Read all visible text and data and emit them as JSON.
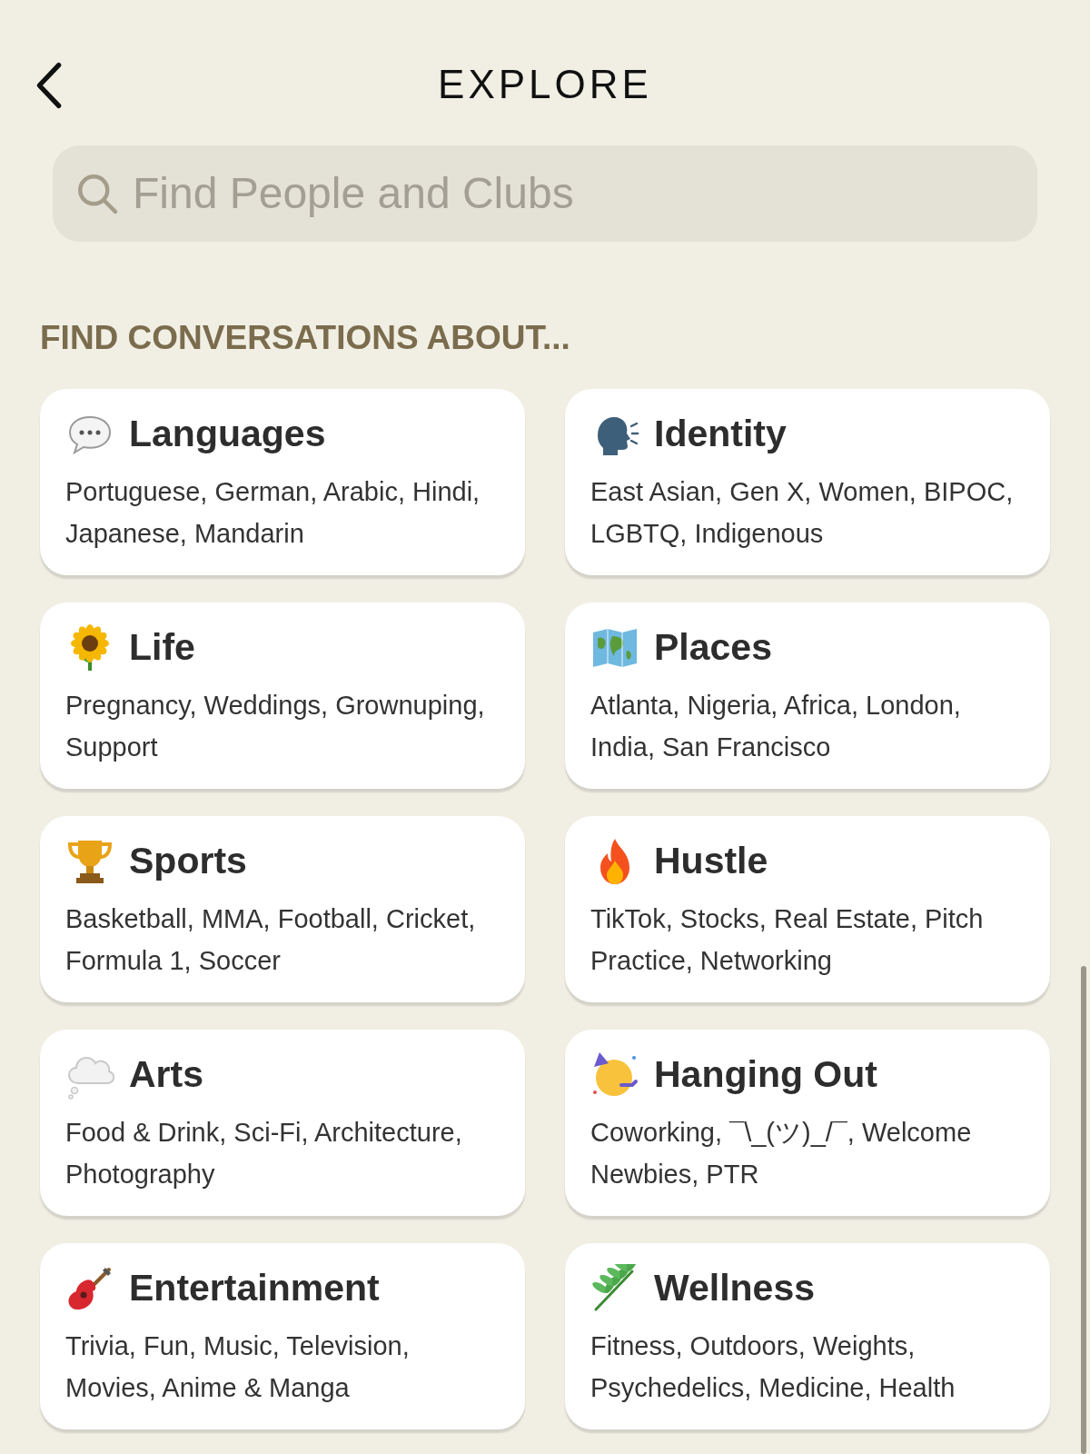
{
  "header": {
    "title": "EXPLORE"
  },
  "search": {
    "placeholder": "Find People and Clubs"
  },
  "section": {
    "title": "FIND CONVERSATIONS ABOUT..."
  },
  "topics": [
    {
      "title": "Languages",
      "subtitle": "Portuguese, German, Arabic, Hindi, Japanese, Mandarin"
    },
    {
      "title": "Identity",
      "subtitle": "East Asian, Gen X, Women, BIPOC, LGBTQ, Indigenous"
    },
    {
      "title": "Life",
      "subtitle": "Pregnancy, Weddings, Grownuping, Support"
    },
    {
      "title": "Places",
      "subtitle": "Atlanta, Nigeria, Africa, London, India, San Francisco"
    },
    {
      "title": "Sports",
      "subtitle": "Basketball, MMA, Football, Cricket, Formula 1, Soccer"
    },
    {
      "title": "Hustle",
      "subtitle": "TikTok, Stocks, Real Estate, Pitch Practice, Networking"
    },
    {
      "title": "Arts",
      "subtitle": "Food & Drink, Sci-Fi, Architecture, Photography"
    },
    {
      "title": "Hanging Out",
      "subtitle": "Coworking, ¯\\_(ツ)_/¯, Welcome Newbies, PTR"
    },
    {
      "title": "Entertainment",
      "subtitle": "Trivia, Fun, Music, Television, Movies, Anime & Manga"
    },
    {
      "title": "Wellness",
      "subtitle": "Fitness, Outdoors, Weights, Psychedelics, Medicine, Health"
    }
  ]
}
